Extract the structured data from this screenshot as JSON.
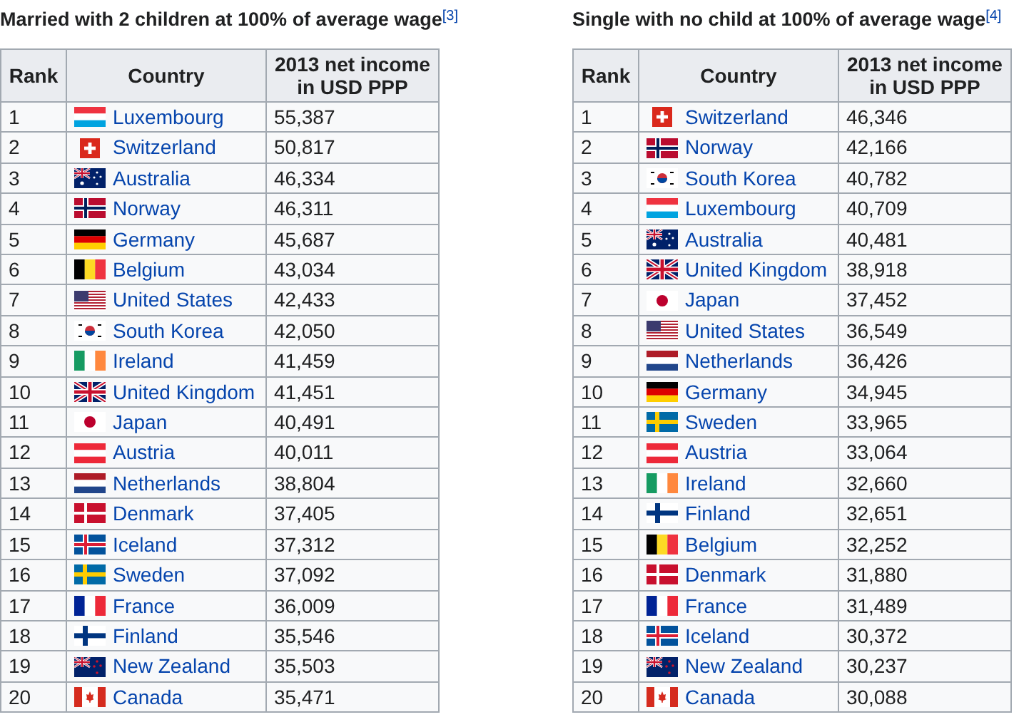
{
  "tables": [
    {
      "title": "Married with 2 children at 100% of average wage$^{[3]}$",
      "columns": [
        "Rank",
        "Country",
        "2013 net income in USD PPP"
      ],
      "rows": [
        {
          "rank": "1",
          "kind": "lu",
          "country": "Luxembourg",
          "income": "55,387"
        },
        {
          "rank": "2",
          "kind": "ch",
          "country": "Switzerland",
          "income": "50,817"
        },
        {
          "rank": "3",
          "kind": "au",
          "country": "Australia",
          "income": "46,334"
        },
        {
          "rank": "4",
          "kind": "no",
          "country": "Norway",
          "income": "46,311"
        },
        {
          "rank": "5",
          "kind": "de",
          "country": "Germany",
          "income": "45,687"
        },
        {
          "rank": "6",
          "kind": "be",
          "country": "Belgium",
          "income": "43,034"
        },
        {
          "rank": "7",
          "kind": "us",
          "country": "United States",
          "income": "42,433"
        },
        {
          "rank": "8",
          "kind": "kr",
          "country": "South Korea",
          "income": "42,050"
        },
        {
          "rank": "9",
          "kind": "ie",
          "country": "Ireland",
          "income": "41,459"
        },
        {
          "rank": "10",
          "kind": "gb",
          "country": "United Kingdom",
          "income": "41,451"
        },
        {
          "rank": "11",
          "kind": "jp",
          "country": "Japan",
          "income": "40,491"
        },
        {
          "rank": "12",
          "kind": "at",
          "country": "Austria",
          "income": "40,011"
        },
        {
          "rank": "13",
          "kind": "nl",
          "country": "Netherlands",
          "income": "38,804"
        },
        {
          "rank": "14",
          "kind": "dk",
          "country": "Denmark",
          "income": "37,405"
        },
        {
          "rank": "15",
          "kind": "is",
          "country": "Iceland",
          "income": "37,312"
        },
        {
          "rank": "16",
          "kind": "se",
          "country": "Sweden",
          "income": "37,092"
        },
        {
          "rank": "17",
          "kind": "fr",
          "country": "France",
          "income": "36,009"
        },
        {
          "rank": "18",
          "kind": "fi",
          "country": "Finland",
          "income": "35,546"
        },
        {
          "rank": "19",
          "kind": "nz",
          "country": "New Zealand",
          "income": "35,503"
        },
        {
          "rank": "20",
          "kind": "ca",
          "country": "Canada",
          "income": "35,471"
        }
      ]
    },
    {
      "title": "Single with no child at 100% of average wage$^{[4]}$",
      "columns": [
        "Rank",
        "Country",
        "2013 net income in USD PPP"
      ],
      "rows": [
        {
          "rank": "1",
          "kind": "ch",
          "country": "Switzerland",
          "income": "46,346"
        },
        {
          "rank": "2",
          "kind": "no",
          "country": "Norway",
          "income": "42,166"
        },
        {
          "rank": "3",
          "kind": "kr",
          "country": "South Korea",
          "income": "40,782"
        },
        {
          "rank": "4",
          "kind": "lu",
          "country": "Luxembourg",
          "income": "40,709"
        },
        {
          "rank": "5",
          "kind": "au",
          "country": "Australia",
          "income": "40,481"
        },
        {
          "rank": "6",
          "kind": "gb",
          "country": "United Kingdom",
          "income": "38,918"
        },
        {
          "rank": "7",
          "kind": "jp",
          "country": "Japan",
          "income": "37,452"
        },
        {
          "rank": "8",
          "kind": "us",
          "country": "United States",
          "income": "36,549"
        },
        {
          "rank": "9",
          "kind": "nl",
          "country": "Netherlands",
          "income": "36,426"
        },
        {
          "rank": "10",
          "kind": "de",
          "country": "Germany",
          "income": "34,945"
        },
        {
          "rank": "11",
          "kind": "se",
          "country": "Sweden",
          "income": "33,965"
        },
        {
          "rank": "12",
          "kind": "at",
          "country": "Austria",
          "income": "33,064"
        },
        {
          "rank": "13",
          "kind": "ie",
          "country": "Ireland",
          "income": "32,660"
        },
        {
          "rank": "14",
          "kind": "fi",
          "country": "Finland",
          "income": "32,651"
        },
        {
          "rank": "15",
          "kind": "be",
          "country": "Belgium",
          "income": "32,252"
        },
        {
          "rank": "16",
          "kind": "dk",
          "country": "Denmark",
          "income": "31,880"
        },
        {
          "rank": "17",
          "kind": "fr",
          "country": "France",
          "income": "31,489"
        },
        {
          "rank": "18",
          "kind": "is",
          "country": "Iceland",
          "income": "30,372"
        },
        {
          "rank": "19",
          "kind": "nz",
          "country": "New Zealand",
          "income": "30,237"
        },
        {
          "rank": "20",
          "kind": "ca",
          "country": "Canada",
          "income": "30,088"
        }
      ]
    }
  ]
}
